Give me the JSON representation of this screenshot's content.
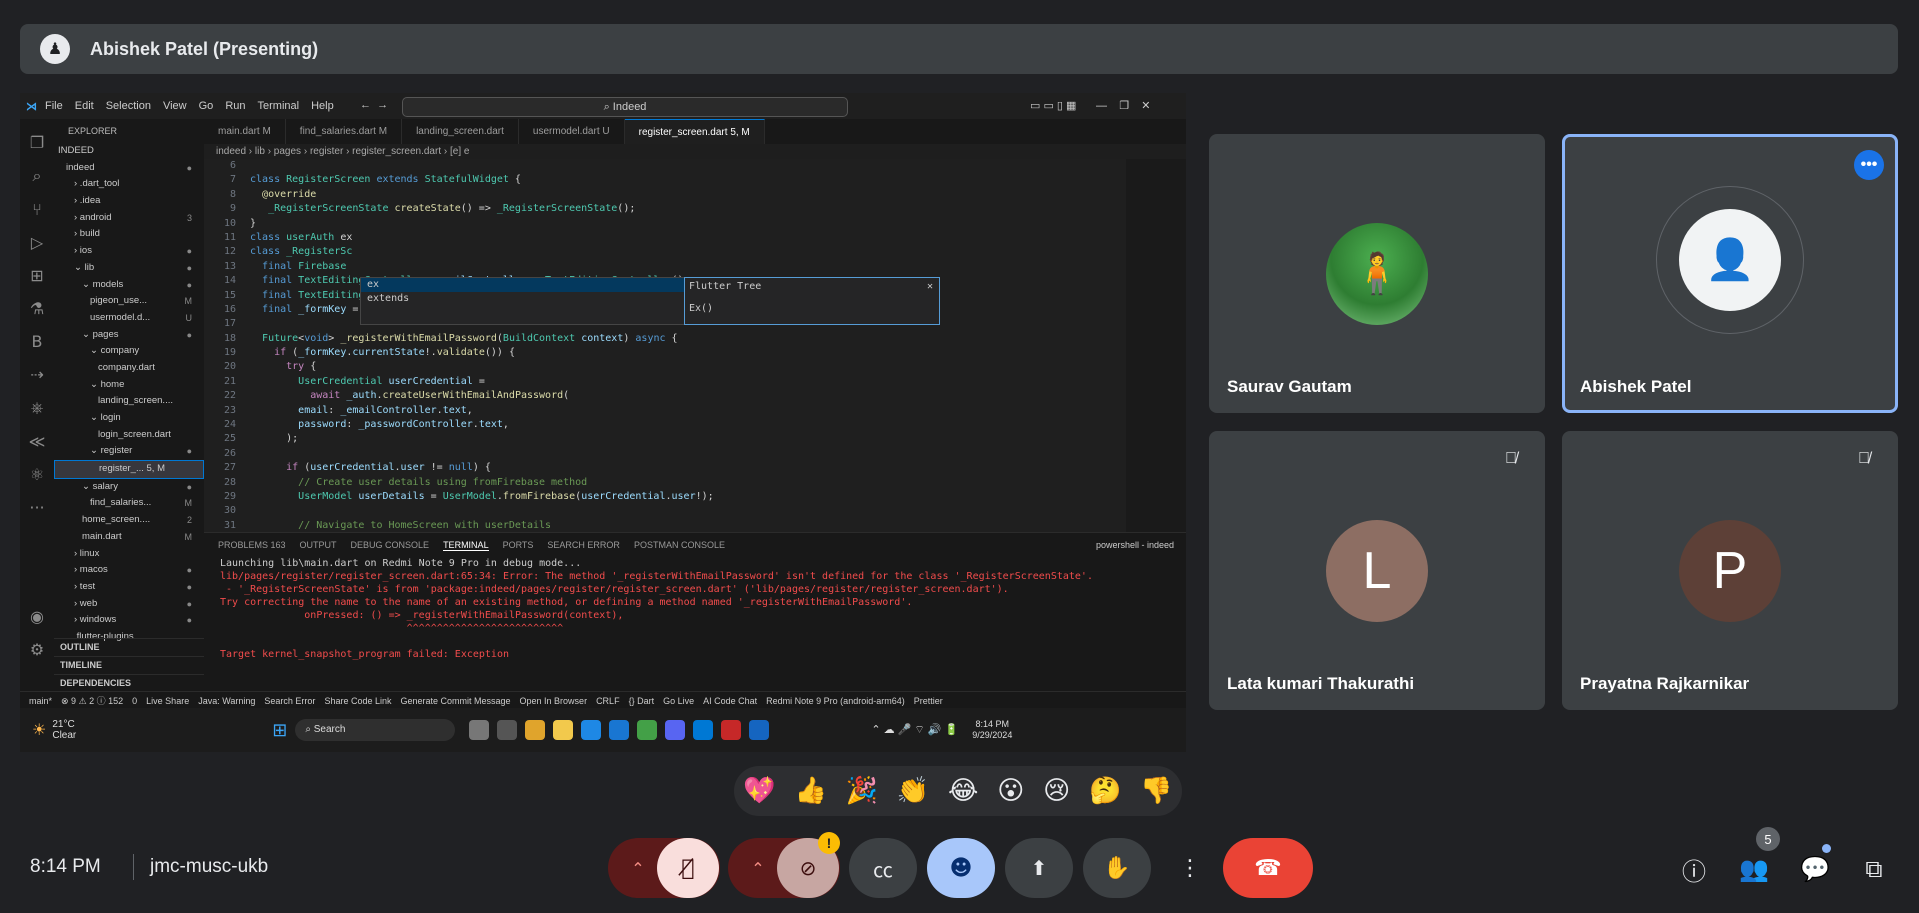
{
  "presenter_bar": {
    "title": "Abishek Patel (Presenting)"
  },
  "shared_screen": {
    "menu": [
      "File",
      "Edit",
      "Selection",
      "View",
      "Go",
      "Run",
      "Terminal",
      "Help"
    ],
    "search": "Indeed",
    "explorer_title": "EXPLORER",
    "tree": [
      {
        "label": "INDEED",
        "indent": 0,
        "mark": ""
      },
      {
        "label": "indeed",
        "indent": 1,
        "mark": "●"
      },
      {
        "label": "› .dart_tool",
        "indent": 2,
        "mark": ""
      },
      {
        "label": "› .idea",
        "indent": 2,
        "mark": ""
      },
      {
        "label": "› android",
        "indent": 2,
        "mark": "3"
      },
      {
        "label": "› build",
        "indent": 2,
        "mark": ""
      },
      {
        "label": "› ios",
        "indent": 2,
        "mark": "●"
      },
      {
        "label": "⌄ lib",
        "indent": 2,
        "mark": "●"
      },
      {
        "label": "⌄ models",
        "indent": 3,
        "mark": "●"
      },
      {
        "label": "pigeon_use...",
        "indent": 4,
        "mark": "M"
      },
      {
        "label": "usermodel.d...",
        "indent": 4,
        "mark": "U"
      },
      {
        "label": "⌄ pages",
        "indent": 3,
        "mark": "●"
      },
      {
        "label": "⌄ company",
        "indent": 4,
        "mark": ""
      },
      {
        "label": "company.dart",
        "indent": 5,
        "mark": ""
      },
      {
        "label": "⌄ home",
        "indent": 4,
        "mark": ""
      },
      {
        "label": "landing_screen....",
        "indent": 5,
        "mark": ""
      },
      {
        "label": "⌄ login",
        "indent": 4,
        "mark": ""
      },
      {
        "label": "login_screen.dart",
        "indent": 5,
        "mark": ""
      },
      {
        "label": "⌄ register",
        "indent": 4,
        "mark": "●"
      },
      {
        "label": "register_... 5, M",
        "indent": 5,
        "mark": ""
      },
      {
        "label": "⌄ salary",
        "indent": 3,
        "mark": "●"
      },
      {
        "label": "find_salaries...",
        "indent": 4,
        "mark": "M"
      },
      {
        "label": "home_screen....",
        "indent": 3,
        "mark": "2"
      },
      {
        "label": "main.dart",
        "indent": 3,
        "mark": "M"
      },
      {
        "label": "› linux",
        "indent": 2,
        "mark": ""
      },
      {
        "label": "› macos",
        "indent": 2,
        "mark": "●"
      },
      {
        "label": "› test",
        "indent": 2,
        "mark": "●"
      },
      {
        "label": "› web",
        "indent": 2,
        "mark": "●"
      },
      {
        "label": "› windows",
        "indent": 2,
        "mark": "●"
      },
      {
        "label": ".flutter-plugins",
        "indent": 2,
        "mark": ""
      }
    ],
    "sections": [
      "OUTLINE",
      "TIMELINE",
      "DEPENDENCIES"
    ],
    "tabs": [
      "main.dart M",
      "find_salaries.dart M",
      "landing_screen.dart",
      "usermodel.dart U",
      "register_screen.dart 5, M"
    ],
    "breadcrumb": "indeed › lib › pages › register › register_screen.dart › [e] e",
    "suggest": {
      "item1": "ex",
      "item2": "extends",
      "tree_title": "Flutter Tree",
      "tree_body": "Ex()"
    },
    "panel_tabs": [
      "PROBLEMS 163",
      "OUTPUT",
      "DEBUG CONSOLE",
      "TERMINAL",
      "PORTS",
      "SEARCH ERROR",
      "POSTMAN CONSOLE"
    ],
    "terminal_title": "powershell - indeed",
    "terminal": [
      {
        "t": "Launching lib\\main.dart on Redmi Note 9 Pro in debug mode...",
        "c": "#cccccc"
      },
      {
        "t": "lib/pages/register/register_screen.dart:65:34: Error: The method '_registerWithEmailPassword' isn't defined for the class '_RegisterScreenState'.",
        "c": "#f14c4c"
      },
      {
        "t": " - '_RegisterScreenState' is from 'package:indeed/pages/register/register_screen.dart' ('lib/pages/register/register_screen.dart').",
        "c": "#f14c4c"
      },
      {
        "t": "Try correcting the name to the name of an existing method, or defining a method named '_registerWithEmailPassword'.",
        "c": "#f14c4c"
      },
      {
        "t": "              onPressed: () => _registerWithEmailPassword(context),",
        "c": "#f14c4c"
      },
      {
        "t": "                               ^^^^^^^^^^^^^^^^^^^^^^^^^^",
        "c": "#f14c4c"
      },
      {
        "t": "",
        "c": "#cccccc"
      },
      {
        "t": "Target kernel_snapshot_program failed: Exception",
        "c": "#f14c4c"
      }
    ],
    "status": [
      "main*",
      "⊗ 9 ⚠ 2 ⓘ 152",
      "0",
      "Live Share",
      "Java: Warning",
      "Search Error",
      "Share Code Link",
      "Generate Commit Message",
      "Open In Browser",
      "CRLF",
      "{} Dart",
      "Go Live",
      "AI Code Chat",
      "Redmi Note 9 Pro (android-arm64)",
      "Prettier"
    ],
    "weather": {
      "temp": "21°C",
      "desc": "Clear"
    },
    "taskbar_search": "Search",
    "taskbar_time": "8:14 PM",
    "taskbar_date": "9/29/2024"
  },
  "participants": [
    {
      "name": "Saurav Gautam",
      "initial": "",
      "muted": false
    },
    {
      "name": "Abishek Patel",
      "initial": "",
      "muted": false
    },
    {
      "name": "Lata kumari Thakurathi",
      "initial": "L",
      "muted": true,
      "color": "#8d6e63"
    },
    {
      "name": "Prayatna Rajkarnikar",
      "initial": "P",
      "muted": true,
      "color": "#5d4037"
    }
  ],
  "reactions": [
    "💖",
    "👍",
    "🎉",
    "👏",
    "😂",
    "😮",
    "😢",
    "🤔",
    "👎"
  ],
  "bottom": {
    "time": "8:14 PM",
    "meeting_code": "jmc-musc-ukb",
    "people_count": "5"
  },
  "colors": {
    "background": "#202124",
    "tile": "#3c4043",
    "leave": "#ea4335",
    "mic_off": "#f9dedc",
    "highlight": "#8ab4f8"
  }
}
